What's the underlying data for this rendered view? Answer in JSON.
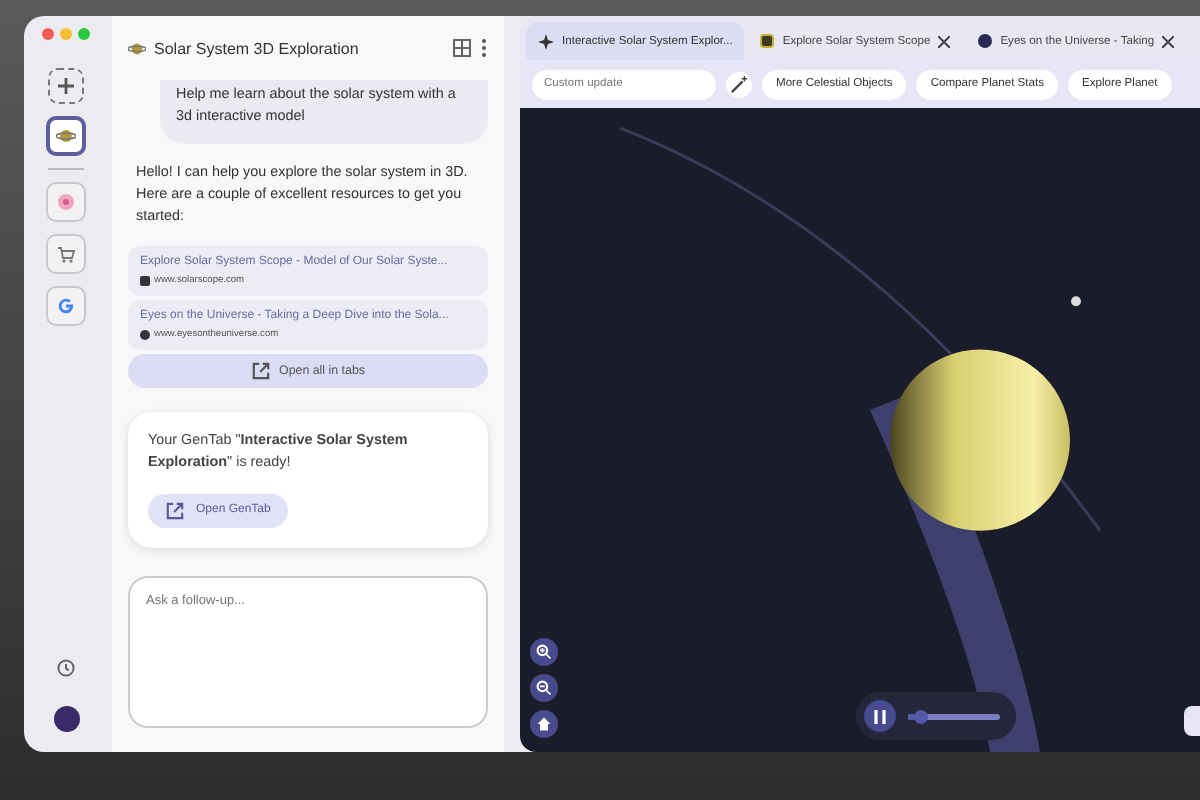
{
  "chat": {
    "title": "Solar System 3D Exploration",
    "user_message": "Help me learn about the solar system with a 3d interactive model",
    "reply": "Hello! I can help you explore the solar system in 3D. Here are a couple of excellent resources to get you started:",
    "links": [
      {
        "title": "Explore Solar System Scope - Model of Our Solar Syste...",
        "url": "www.solarscope.com"
      },
      {
        "title": "Eyes on the Universe - Taking a Deep Dive into the Sola...",
        "url": "www.eyesontheuniverse.com"
      }
    ],
    "open_all": "Open all in tabs",
    "gentab_message": "Your GenTab \"**Interactive Solar System Exploration**\" is ready!",
    "open_gentab": "Open GenTab",
    "input_placeholder": "Ask a follow-up..."
  },
  "rail": {
    "items": [
      {
        "kind": "new"
      },
      {
        "kind": "planet",
        "selected": true
      },
      {
        "kind": "flower",
        "selected": false
      },
      {
        "kind": "cart",
        "selected": false
      },
      {
        "kind": "google",
        "selected": false
      }
    ]
  },
  "tabs": [
    {
      "label": "Interactive Solar System Explor...",
      "selected": true,
      "closable": false
    },
    {
      "label": "Explore Solar System Scope",
      "selected": false,
      "closable": true
    },
    {
      "label": "Eyes on the Universe - Taking",
      "selected": false,
      "closable": true
    }
  ],
  "toolbar": {
    "placeholder": "Custom update",
    "chips": [
      "More Celestial Objects",
      "Compare Planet Stats",
      "Explore Planet"
    ]
  },
  "viewer": {
    "speed": {
      "level": 0.12
    }
  }
}
